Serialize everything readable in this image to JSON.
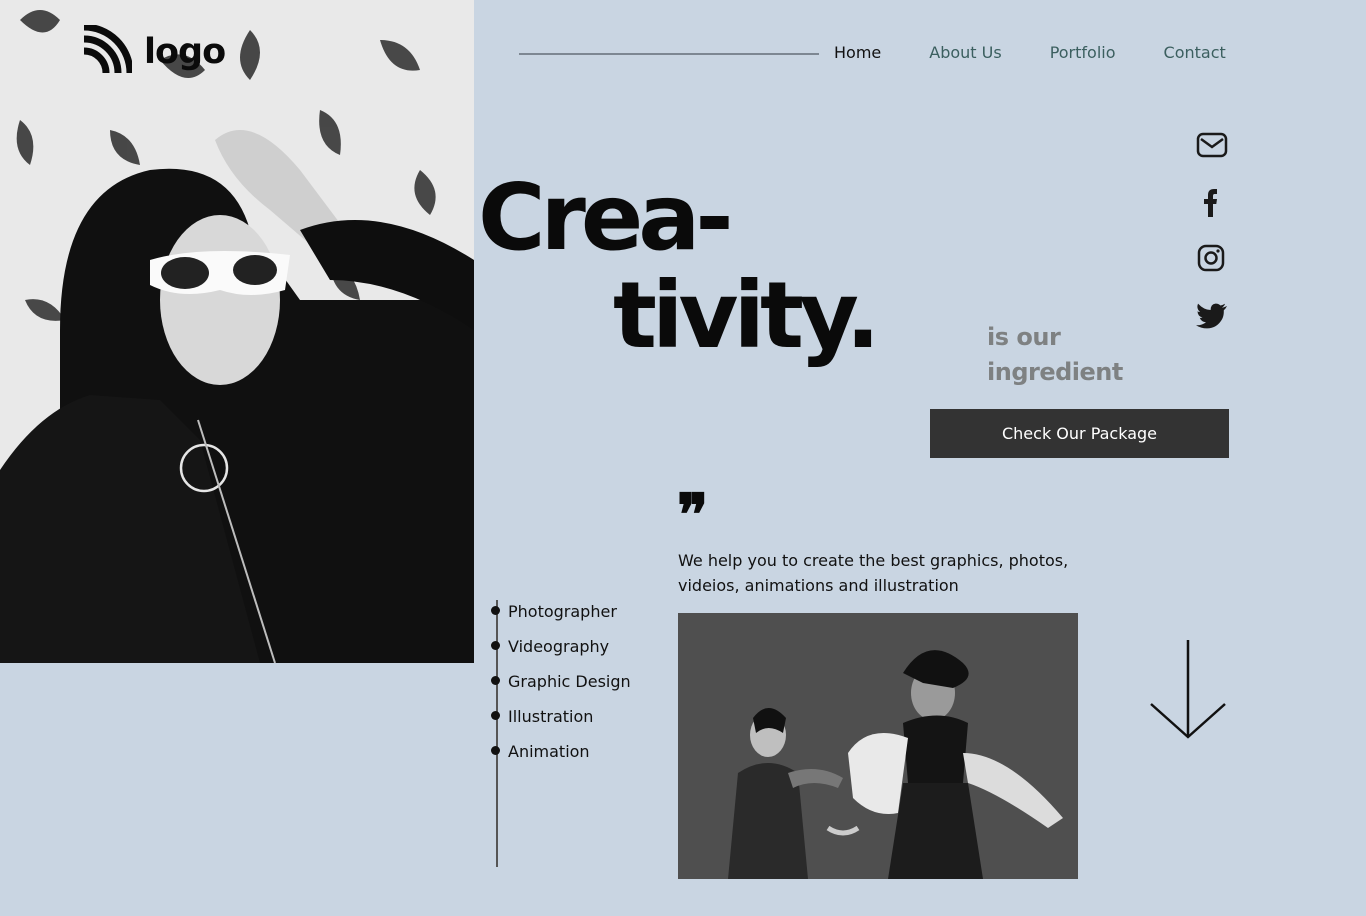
{
  "brand": {
    "logo_text": "logo",
    "logo_icon": "signal-arcs-icon"
  },
  "nav": {
    "items": [
      {
        "label": "Home",
        "active": true
      },
      {
        "label": "About Us",
        "active": false
      },
      {
        "label": "Portfolio",
        "active": false
      },
      {
        "label": "Contact",
        "active": false
      }
    ]
  },
  "hero": {
    "headline_line1": "Crea-",
    "headline_line2": "tivity.",
    "tagline": "is our ingredient",
    "cta_label": "Check Our Package"
  },
  "socials": [
    "mail-icon",
    "facebook-icon",
    "instagram-icon",
    "twitter-icon"
  ],
  "quote": {
    "mark": "❞",
    "text": "We help you to create the best graphics, photos, videios, animations and illustration"
  },
  "services": [
    "Photographer",
    "Videography",
    "Graphic Design",
    "Illustration",
    "Animation"
  ],
  "colors": {
    "background": "#c9d5e2",
    "nav_link": "#3b5f5f",
    "button": "#333333",
    "tagline": "#7e8182"
  }
}
